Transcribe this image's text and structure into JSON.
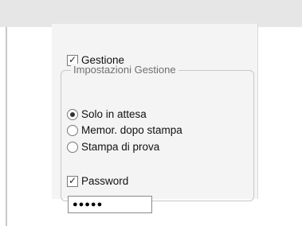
{
  "gestione_checkbox": {
    "label": "Gestione",
    "checked": true,
    "check_glyph": "✓"
  },
  "groupbox": {
    "title": "Impostazioni Gestione",
    "radios": [
      {
        "label": "Solo in attesa",
        "selected": true
      },
      {
        "label": "Memor. dopo stampa",
        "selected": false
      },
      {
        "label": "Stampa di prova",
        "selected": false
      }
    ],
    "password_checkbox": {
      "label": "Password",
      "checked": true,
      "check_glyph": "✓"
    },
    "password_field": {
      "value": "●●●●●"
    }
  }
}
